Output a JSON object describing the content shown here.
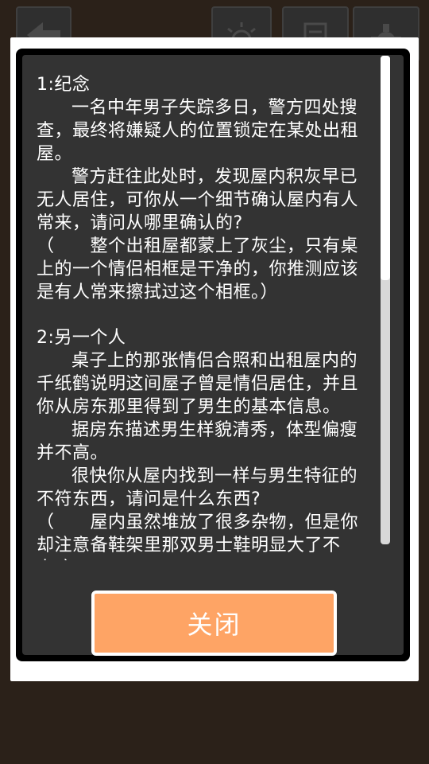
{
  "toolbar": {
    "back_icon": "back-arrow-icon",
    "light_icon": "lightbulb-icon",
    "notes_icon": "notes-icon",
    "settings_icon": "gear-icon"
  },
  "dialog": {
    "entries": [
      {
        "title": "1:纪念",
        "paragraphs": [
          "一名中年男子失踪多日，警方四处搜查，最终将嫌疑人的位置锁定在某处出租屋。",
          "警方赶往此处时，发现屋内积灰早已无人居住，可你从一个细节确认屋内有人常来，请问从哪里确认的?"
        ],
        "hint": "（　　整个出租屋都蒙上了灰尘，只有桌上的一个情侣相框是干净的，你推测应该是有人常来擦拭过这个相框。）"
      },
      {
        "title": "2:另一个人",
        "paragraphs": [
          "桌子上的那张情侣合照和出租屋内的千纸鹤说明这间屋子曾是情侣居住，并且你从房东那里得到了男生的基本信息。",
          "据房东描述男生样貌清秀，体型偏瘦并不高。",
          "很快你从屋内找到一样与男生特征的不符东西，请问是什么东西?"
        ],
        "hint": "（　　屋内虽然堆放了很多杂物，但是你却注意备鞋架里那双男士鞋明显大了不少。）"
      }
    ],
    "close_label": "关闭",
    "scroll_fraction": 0.46
  },
  "colors": {
    "background": "#2b2119",
    "panel": "#333333",
    "close_button": "#fea465"
  }
}
